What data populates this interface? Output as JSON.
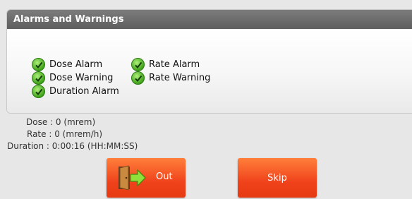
{
  "panel": {
    "title": "Alarms and Warnings",
    "alarms": [
      {
        "label": "Dose Alarm",
        "icon": "check-icon"
      },
      {
        "label": "Dose Warning",
        "icon": "check-icon"
      },
      {
        "label": "Duration Alarm",
        "icon": "check-icon"
      },
      {
        "label": "Rate Alarm",
        "icon": "check-icon"
      },
      {
        "label": "Rate Warning",
        "icon": "check-icon"
      }
    ]
  },
  "readings": {
    "dose": "Dose : 0 (mrem)",
    "rate": "Rate : 0 (mrem/h)",
    "duration": "Duration : 0:00:16 (HH:MM:SS)"
  },
  "buttons": {
    "out": {
      "label": "Out",
      "icon": "exit-door-icon"
    },
    "skip": {
      "label": "Skip"
    }
  },
  "colors": {
    "header": "#6b6b6b",
    "button": "#f2481e",
    "check": "#4fbf23"
  }
}
